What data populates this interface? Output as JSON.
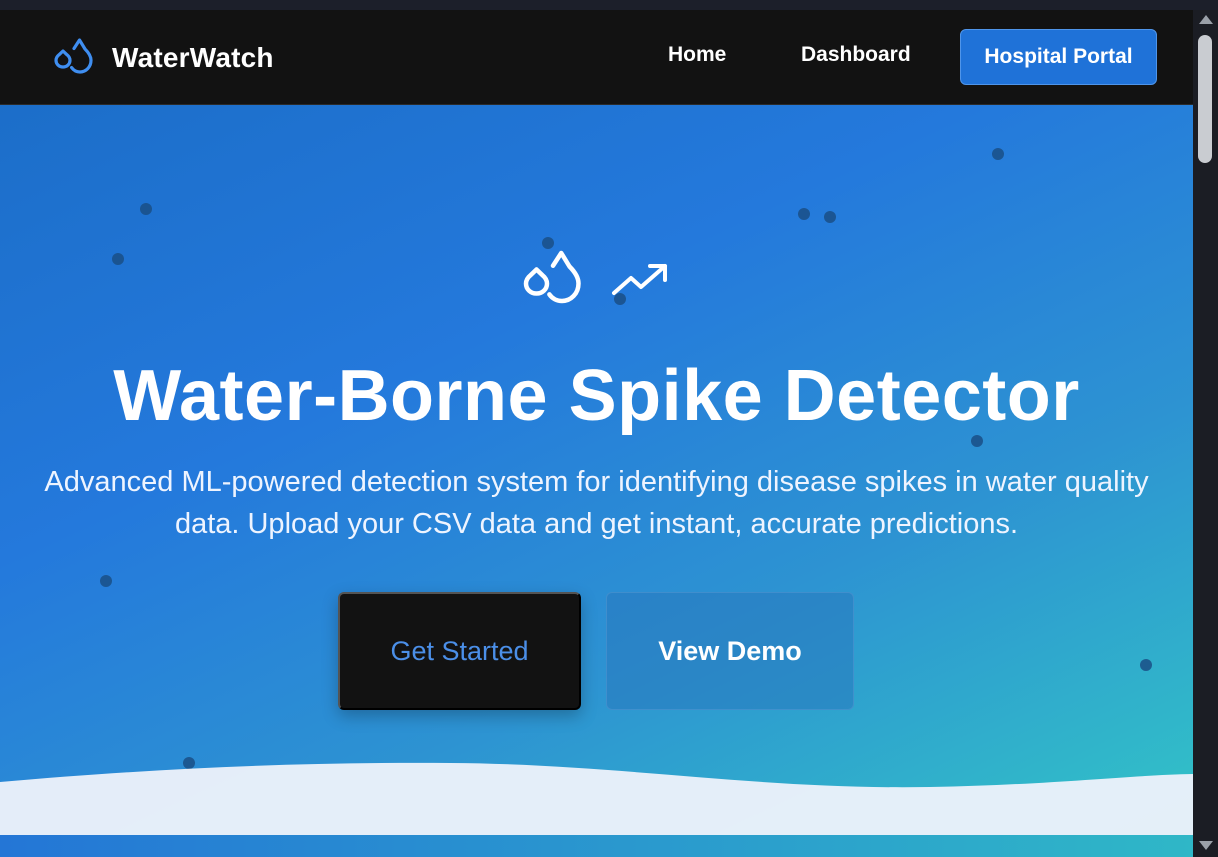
{
  "colors": {
    "navbar_bg": "#121212",
    "accent_blue": "#1f72d8",
    "hero_gradient_start": "#1c6ec9",
    "hero_gradient_end": "#32c6c6",
    "get_started_text": "#4b8fe8"
  },
  "navbar": {
    "brand_icon": "droplets-icon",
    "brand_name": "WaterWatch",
    "links": {
      "home": "Home",
      "dashboard": "Dashboard"
    },
    "portal_button": "Hospital Portal"
  },
  "hero": {
    "icons": [
      "droplets-icon",
      "trending-up-icon"
    ],
    "title": "Water-Borne Spike Detector",
    "subtitle": "Advanced ML-powered detection system for identifying disease spikes in water quality data. Upload your CSV data and get instant, accurate predictions.",
    "primary_button": "Get Started",
    "secondary_button": "View Demo"
  }
}
